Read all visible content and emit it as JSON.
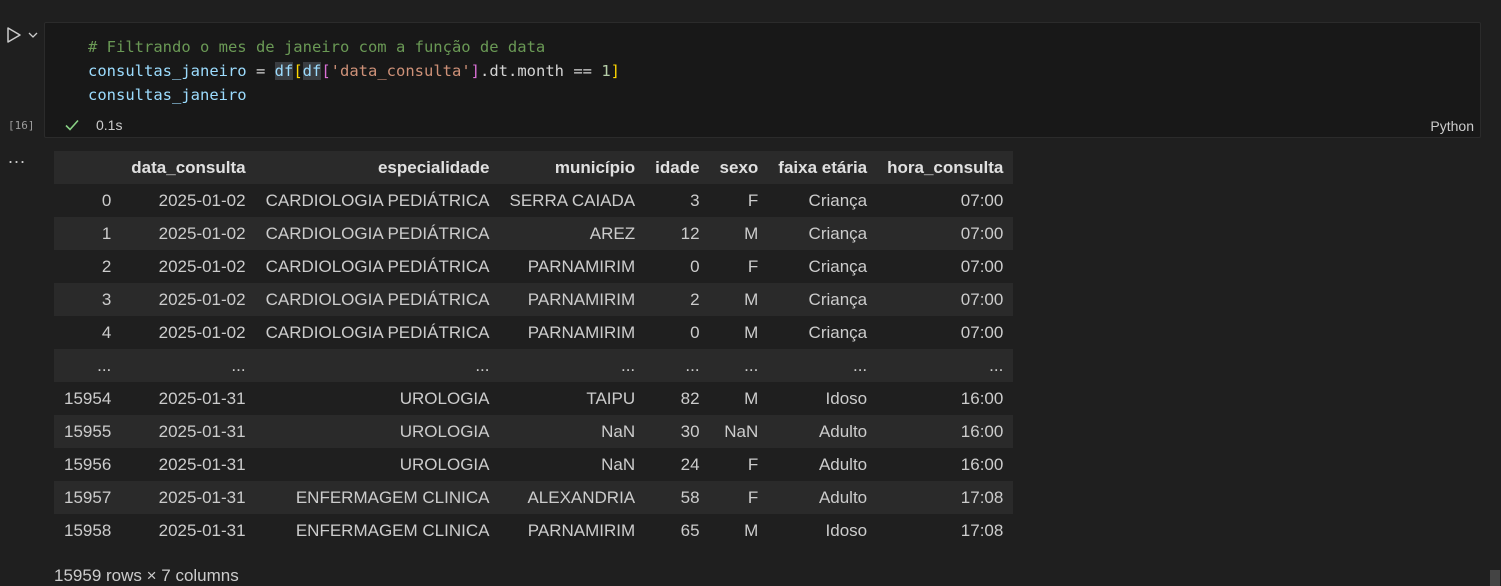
{
  "cell": {
    "execution_count": "[16]",
    "code_lines": {
      "comment": "# Filtrando o mes de janeiro com a função de data",
      "line2_var": "consultas_janeiro",
      "line2_eq": " = ",
      "line2_df1": "df",
      "line2_br_open": "[",
      "line2_df2": "df",
      "line2_br2_open": "[",
      "line2_str": "'data_consulta'",
      "line2_br2_close": "]",
      "line2_attr": ".dt.month == ",
      "line2_num": "1",
      "line2_br_close": "]",
      "line3": "consultas_janeiro"
    },
    "status_time": "0.1s",
    "language": "Python"
  },
  "output": {
    "columns": [
      "",
      "data_consulta",
      "especialidade",
      "município",
      "idade",
      "sexo",
      "faixa etária",
      "hora_consulta"
    ],
    "rows": [
      [
        "0",
        "2025-01-02",
        "CARDIOLOGIA PEDIÁTRICA",
        "SERRA CAIADA",
        "3",
        "F",
        "Criança",
        "07:00"
      ],
      [
        "1",
        "2025-01-02",
        "CARDIOLOGIA PEDIÁTRICA",
        "AREZ",
        "12",
        "M",
        "Criança",
        "07:00"
      ],
      [
        "2",
        "2025-01-02",
        "CARDIOLOGIA PEDIÁTRICA",
        "PARNAMIRIM",
        "0",
        "F",
        "Criança",
        "07:00"
      ],
      [
        "3",
        "2025-01-02",
        "CARDIOLOGIA PEDIÁTRICA",
        "PARNAMIRIM",
        "2",
        "M",
        "Criança",
        "07:00"
      ],
      [
        "4",
        "2025-01-02",
        "CARDIOLOGIA PEDIÁTRICA",
        "PARNAMIRIM",
        "0",
        "M",
        "Criança",
        "07:00"
      ],
      [
        "...",
        "...",
        "...",
        "...",
        "...",
        "...",
        "...",
        "..."
      ],
      [
        "15954",
        "2025-01-31",
        "UROLOGIA",
        "TAIPU",
        "82",
        "M",
        "Idoso",
        "16:00"
      ],
      [
        "15955",
        "2025-01-31",
        "UROLOGIA",
        "NaN",
        "30",
        "NaN",
        "Adulto",
        "16:00"
      ],
      [
        "15956",
        "2025-01-31",
        "UROLOGIA",
        "NaN",
        "24",
        "F",
        "Adulto",
        "16:00"
      ],
      [
        "15957",
        "2025-01-31",
        "ENFERMAGEM CLINICA",
        "ALEXANDRIA",
        "58",
        "F",
        "Adulto",
        "17:08"
      ],
      [
        "15958",
        "2025-01-31",
        "ENFERMAGEM CLINICA",
        "PARNAMIRIM",
        "65",
        "M",
        "Idoso",
        "17:08"
      ]
    ],
    "shape_text": "15959 rows × 7 columns",
    "more_label": "..."
  }
}
